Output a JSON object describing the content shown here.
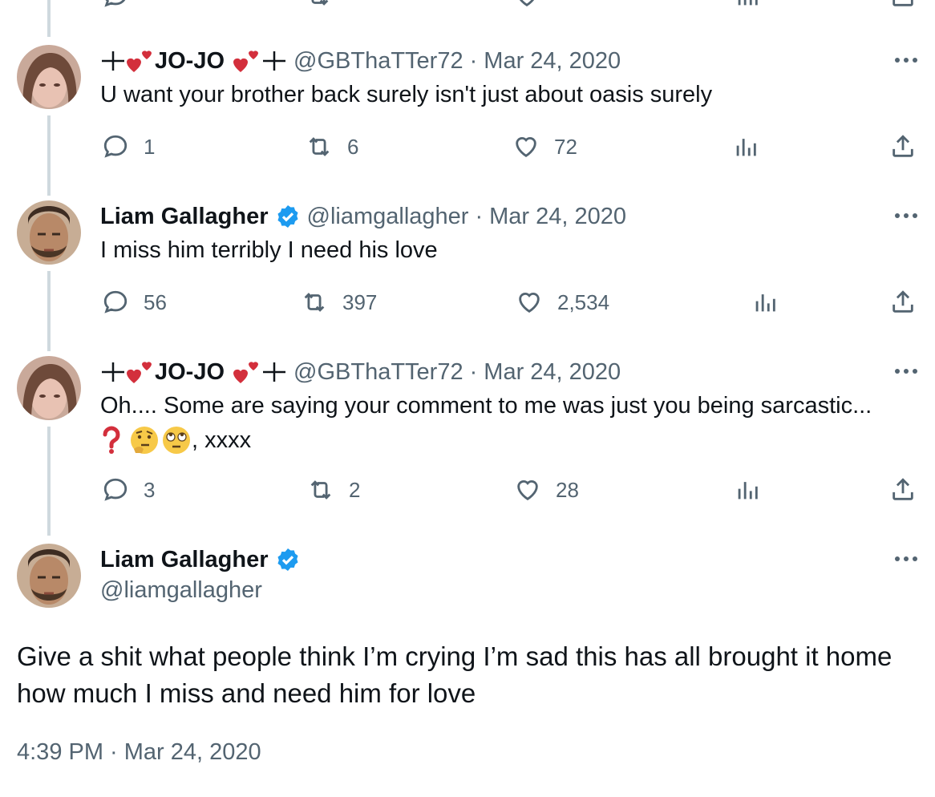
{
  "colors": {
    "text": "#0f1419",
    "secondary": "#536471",
    "thread_line": "#cfd9de",
    "verified": "#1d9bf0",
    "heart_deco": "#d32f3c"
  },
  "tweets": [
    {
      "name": "JO-JO",
      "handle": "@GBThaTTer72",
      "date": "Mar 24, 2020",
      "text": "U want your brother back surely isn't just about oasis surely",
      "stats": {
        "replies": "1",
        "retweets": "6",
        "likes": "72"
      }
    },
    {
      "name": "Liam Gallagher",
      "handle": "@liamgallagher",
      "date": "Mar 24, 2020",
      "text": "I miss him terribly I need his love",
      "stats": {
        "replies": "56",
        "retweets": "397",
        "likes": "2,534"
      }
    },
    {
      "name": "JO-JO",
      "handle": "@GBThaTTer72",
      "date": "Mar 24, 2020",
      "text": "Oh.... Some are saying your comment to me was just you being sarcastic...",
      "text_line2": ", xxxx",
      "stats": {
        "replies": "3",
        "retweets": "2",
        "likes": "28"
      }
    }
  ],
  "main_tweet": {
    "name": "Liam Gallagher",
    "handle": "@liamgallagher",
    "text": "Give a shit what people think I’m crying I’m sad this has all brought it home how much I miss and need him for love",
    "timestamp": "4:39 PM · Mar 24, 2020"
  },
  "icons": {
    "reply": "reply-icon",
    "retweet": "retweet-icon",
    "like": "heart-icon",
    "views": "analytics-icon",
    "share": "share-icon",
    "more": "more-icon",
    "verified": "verified-badge-icon"
  }
}
